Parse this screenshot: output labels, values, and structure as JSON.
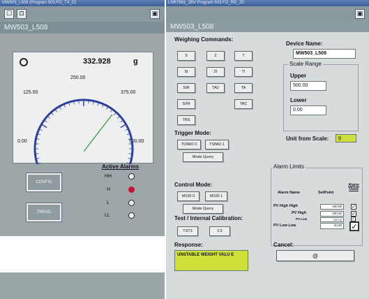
{
  "left_window": {
    "title": "MW503_L508 (Program 503.FO_TX_D)",
    "device_header": "MW503_L508",
    "weight_value": "332.928",
    "weight_unit": "g",
    "gauge": {
      "labels": [
        "125.00",
        "250.00",
        "375.00",
        "0.00",
        "500.00"
      ],
      "min": 0,
      "max": 500,
      "needle_value": 332.928
    },
    "config_label": "CONFIG",
    "trend_label": "TREND",
    "active_alarms_title": "Active Alarms",
    "alarms": [
      {
        "label": "HH",
        "active": false
      },
      {
        "label": "H",
        "active": true
      },
      {
        "label": "L",
        "active": false
      },
      {
        "label": "LL",
        "active": false
      }
    ],
    "active_color": "#c01830"
  },
  "right_window": {
    "title": "LNR7891_2BV Program 503.FO_RD_JD",
    "device_header": "MW503_L508",
    "weighing_commands_title": "Weighing Commands:",
    "weighing_buttons": [
      "S",
      "Z",
      "T",
      "SI",
      "ZI",
      "TI",
      "SIR",
      "TA2",
      "TA",
      "SXR",
      "TAC",
      "TRS"
    ],
    "device_name_label": "Device Name:",
    "device_name_value": "MW503_L508",
    "scale_range_legend": "Scale Range",
    "upper_label": "Upper",
    "upper_value": "500.00",
    "lower_label": "Lower",
    "lower_value": "0.00",
    "trigger_mode_title": "Trigger Mode:",
    "trigger_buttons": [
      "TOIMO 0",
      "TSIMO 1"
    ],
    "trigger_query": "Mode Query",
    "unit_from_scale_label": "Unit from Scale:",
    "unit_from_scale_value": "g",
    "alarm_limits_legend": "Alarm Limits",
    "alarm_headers": [
      "Alarm Name",
      "SetPoint",
      "Alarm Used"
    ],
    "alarm_rows": [
      {
        "name": "PV High High",
        "setpoint": "400.00",
        "checked": true
      },
      {
        "name": "PV High",
        "setpoint": "330.00",
        "checked": true
      },
      {
        "name": "PV Low",
        "setpoint": "100.00",
        "checked": true
      },
      {
        "name": "PV Low Low",
        "setpoint": "20.00",
        "checked": true
      }
    ],
    "control_mode_title": "Control Mode:",
    "control_buttons": [
      "M100 0",
      "M100 1"
    ],
    "control_query": "Mode Query",
    "test_cal_title": "Test / Internal Calibration:",
    "test_buttons": [
      "TST3",
      "C3"
    ],
    "response_label": "Response:",
    "response_value": "UNSTABLE WEIGHT VALU E",
    "cancel_label": "Cancel:",
    "cancel_button_label": "@",
    "accent_yellow": "#cfe03a"
  }
}
